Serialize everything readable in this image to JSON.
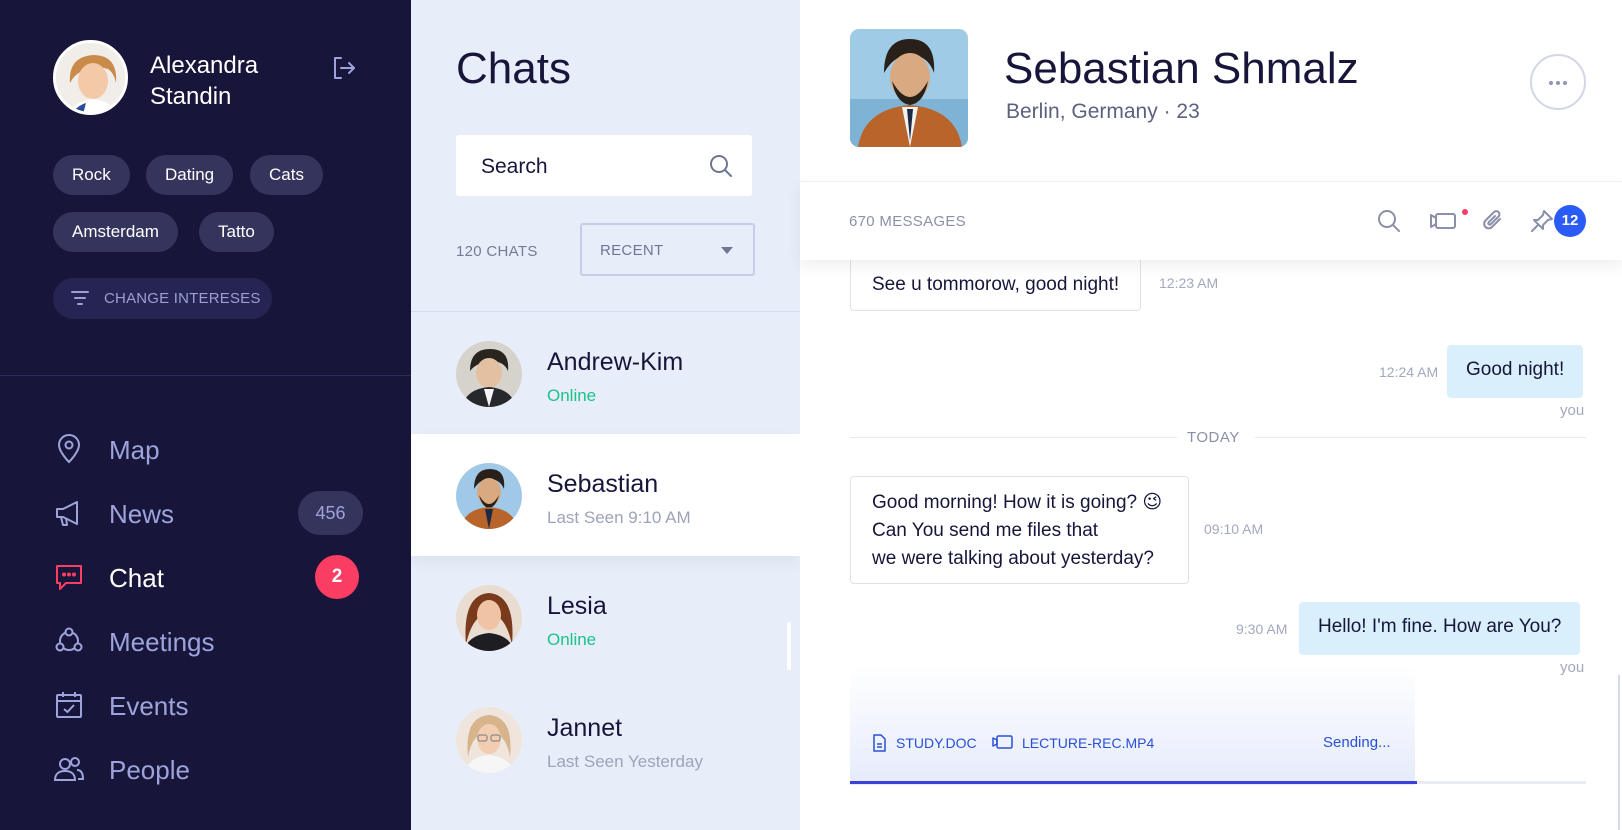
{
  "profile": {
    "name": "Alexandra Standin"
  },
  "interests": [
    "Rock",
    "Dating",
    "Cats",
    "Amsterdam",
    "Tatto"
  ],
  "change_interests_label": "CHANGE INTERESES",
  "nav": [
    {
      "label": "Map",
      "icon": "map-pin-icon"
    },
    {
      "label": "News",
      "icon": "megaphone-icon",
      "count": "456"
    },
    {
      "label": "Chat",
      "icon": "chat-bubble-icon",
      "badge": "2",
      "active": true
    },
    {
      "label": "Meetings",
      "icon": "meetings-icon"
    },
    {
      "label": "Events",
      "icon": "calendar-icon"
    },
    {
      "label": "People",
      "icon": "people-icon"
    }
  ],
  "chatlist": {
    "title": "Chats",
    "search_text": "Search",
    "count_label": "120 CHATS",
    "sort_value": "RECENT",
    "items": [
      {
        "name": "Andrew-Kim",
        "status": "Online",
        "online": true
      },
      {
        "name": "Sebastian",
        "status": "Last Seen 9:10 AM",
        "online": false,
        "active": true
      },
      {
        "name": "Lesia",
        "status": "Online",
        "online": true
      },
      {
        "name": "Jannet",
        "status": "Last Seen Yesterday",
        "online": false
      }
    ]
  },
  "conversation": {
    "name": "Sebastian Shmalz",
    "location": "Berlin, Germany",
    "age": "23",
    "messages_count": "670 MESSAGES",
    "pinned_count": "12",
    "day_separator": "TODAY",
    "messages": [
      {
        "dir": "in",
        "text": "See u tommorow, good night!",
        "time": "12:23 AM"
      },
      {
        "dir": "out",
        "text": "Good night!",
        "time": "12:24 AM",
        "sender": "you"
      },
      {
        "dir": "in",
        "lines": [
          "Good morning! How it is going? 😉",
          "Can You send me files that",
          "we were talking about yesterday?"
        ],
        "time": "09:10 AM"
      },
      {
        "dir": "out",
        "text": "Hello! I'm fine. How are You?",
        "time": "9:30 AM",
        "sender": "you"
      }
    ],
    "upload": {
      "files": [
        "STUDY.DOC",
        "LECTURE-REC.MP4"
      ],
      "status": "Sending...",
      "progress": 0.77
    }
  },
  "colors": {
    "sidebar_bg": "#17163a",
    "accent_badge": "#fb3d63",
    "online": "#1cc28a",
    "pin_badge": "#2a5bf6",
    "outgoing_bubble": "#d9effc"
  }
}
